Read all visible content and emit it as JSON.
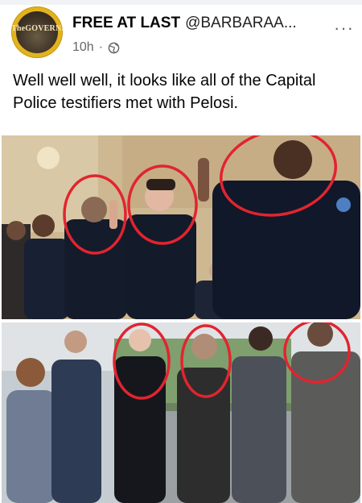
{
  "post": {
    "avatar_text": "TheGOVERNERE",
    "author_name": "FREE AT LAST",
    "author_handle": "@BARBARAA...",
    "time": "10h",
    "separator": "·",
    "more": "···",
    "text": "Well well well, it looks like all of the Capital Police testifiers met with Pelosi."
  },
  "colors": {
    "text_primary": "#050505",
    "text_secondary": "#65676b",
    "circle": "#e2242f"
  }
}
